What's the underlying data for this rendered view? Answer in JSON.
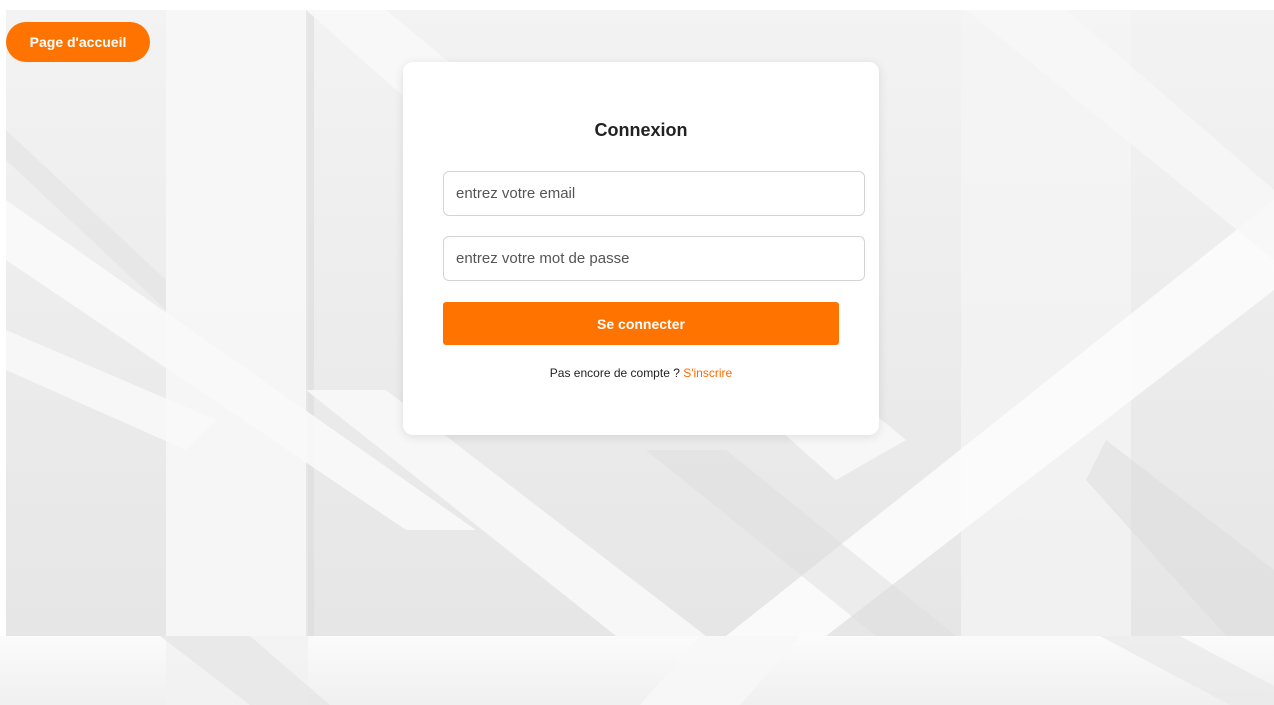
{
  "header": {
    "home_label": "Page d'accueil"
  },
  "login": {
    "title": "Connexion",
    "email": {
      "placeholder": "entrez votre email",
      "value": ""
    },
    "password": {
      "placeholder": "entrez votre mot de passe",
      "value": ""
    },
    "submit_label": "Se connecter",
    "signup_prompt": "Pas encore de compte ?",
    "signup_link": "S'inscrire"
  },
  "colors": {
    "accent": "#ff7400",
    "link": "#ff6a00",
    "card": "#ffffff",
    "background": "#eeeeee"
  }
}
